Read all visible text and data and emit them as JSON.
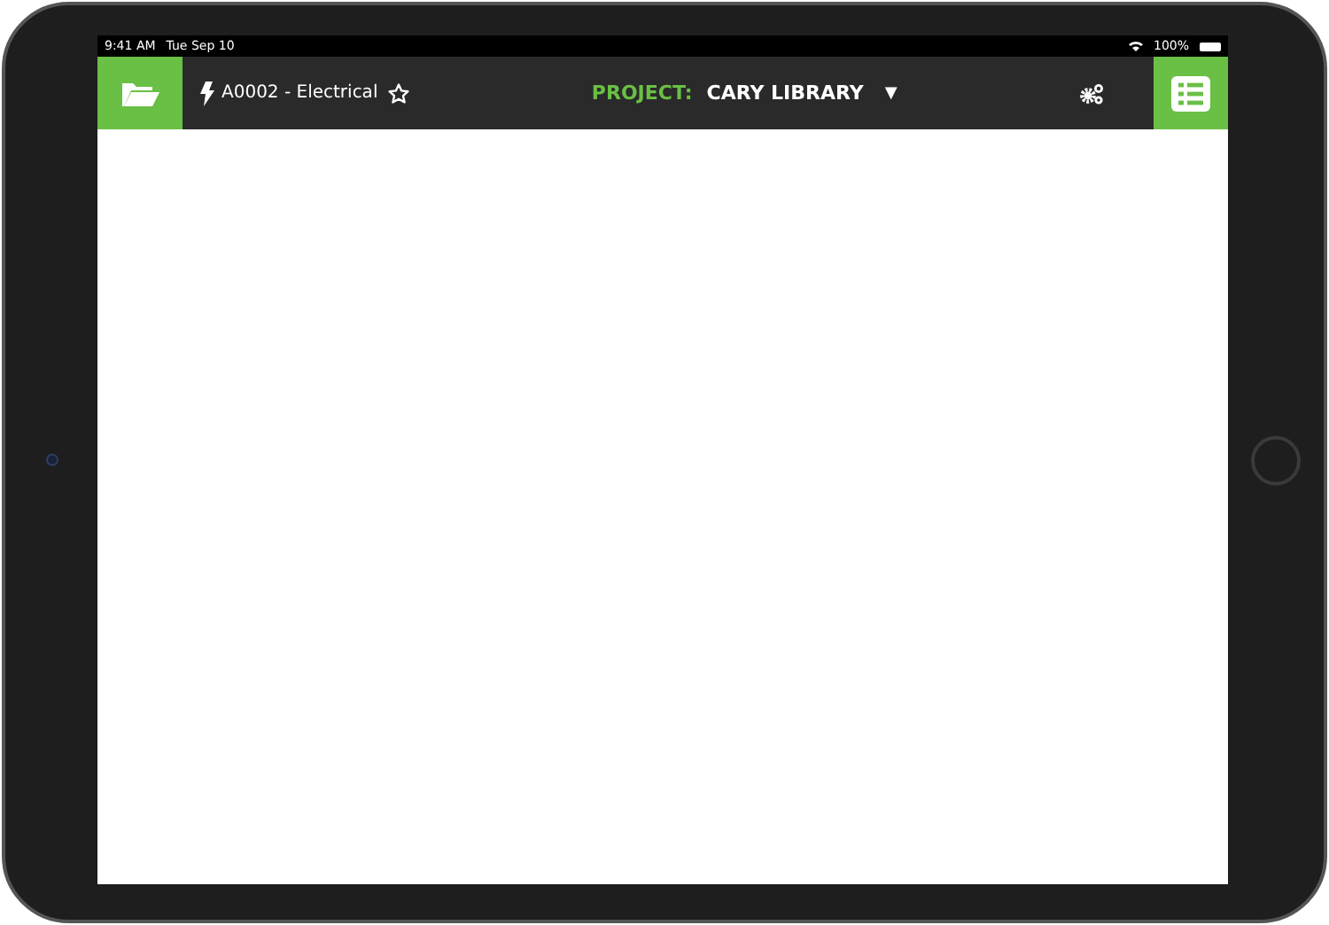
{
  "status_bar": {
    "time": "9:41 AM",
    "date": "Tue Sep 10",
    "battery": "100%"
  },
  "toolbar": {
    "document": "A0002 - Electrical",
    "favorite": false,
    "project_label": "PROJECT:",
    "project_name": "CARY LIBRARY",
    "dropdown": "▼"
  }
}
